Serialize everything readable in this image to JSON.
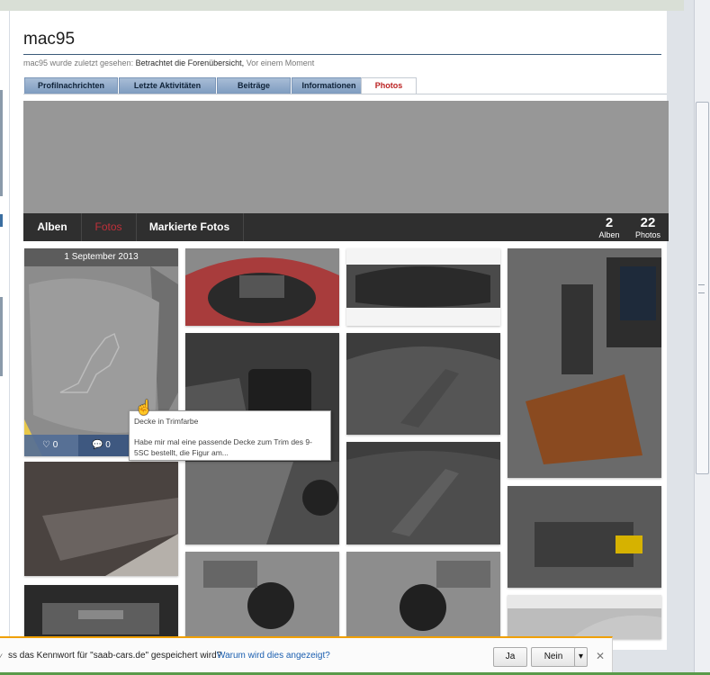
{
  "profile": {
    "username": "mac95",
    "last_seen_prefix": "mac95 wurde zuletzt gesehen:",
    "last_seen_activity": "Betrachtet die Forenübersicht,",
    "last_seen_time": "Vor einem Moment"
  },
  "tabs": [
    {
      "label": "Profilnachrichten"
    },
    {
      "label": "Letzte Aktivitäten"
    },
    {
      "label": "Beiträge"
    },
    {
      "label": "Informationen"
    },
    {
      "label": "Photos",
      "active": true
    }
  ],
  "album_nav": {
    "items": [
      "Alben",
      "Fotos",
      "Markierte Fotos"
    ],
    "active": "Fotos"
  },
  "stats": {
    "albums_count": "2",
    "albums_label": "Alben",
    "photos_count": "22",
    "photos_label": "Photos"
  },
  "featured_photo": {
    "date": "1 September 2013",
    "likes": "0",
    "comments": "0"
  },
  "tooltip": {
    "title": "Decke in Trimfarbe",
    "description": "Habe mir mal eine passende Decke zum Trim des 9-5SC bestellt, die Figur am..."
  },
  "password_bar": {
    "message": "ss das Kennwort für \"saab-cars.de\" gespeichert wird?",
    "why_link": "Warum wird dies angezeigt?",
    "yes_label": "Ja",
    "no_label": "Nein"
  },
  "colors": {
    "tab_active_text": "#bb2222",
    "album_bar_bg": "#2f2f2f",
    "active_nav_text": "#c0303a",
    "notify_border": "#f0a000",
    "link": "#1b5fb0"
  },
  "icons": [
    "heart-icon",
    "comment-icon",
    "cursor-icon",
    "close-icon",
    "chevron-down-icon"
  ]
}
